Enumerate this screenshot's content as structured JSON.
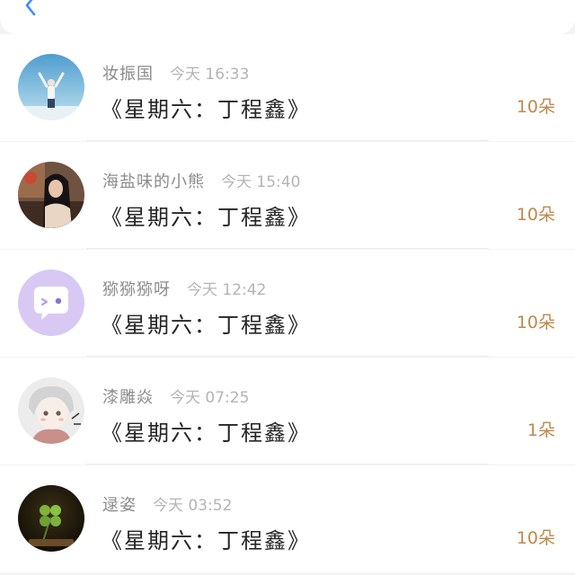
{
  "header": {
    "back_icon": "chevron-left-icon",
    "accent_color": "#3d8bff"
  },
  "items": [
    {
      "name": "妆振国",
      "time": "今天 16:33",
      "content": "《星期六：丁程鑫》",
      "count": "10朵",
      "avatar": "person-sky-avatar"
    },
    {
      "name": "海盐味的小熊",
      "time": "今天 15:40",
      "content": "《星期六：丁程鑫》",
      "count": "10朵",
      "avatar": "girl-photo-avatar"
    },
    {
      "name": "猕猕猕呀",
      "time": "今天 12:42",
      "content": "《星期六：丁程鑫》",
      "count": "10朵",
      "avatar": "chat-bubble-avatar"
    },
    {
      "name": "漆雕焱",
      "time": "今天 07:25",
      "content": "《星期六：丁程鑫》",
      "count": "1朵",
      "avatar": "anime-boy-avatar"
    },
    {
      "name": "逯姿",
      "time": "今天 03:52",
      "content": "《星期六：丁程鑫》",
      "count": "10朵",
      "avatar": "clover-avatar"
    }
  ],
  "colors": {
    "count": "#c0874a",
    "name": "#8b8b8b",
    "time": "#b4b4b4"
  }
}
